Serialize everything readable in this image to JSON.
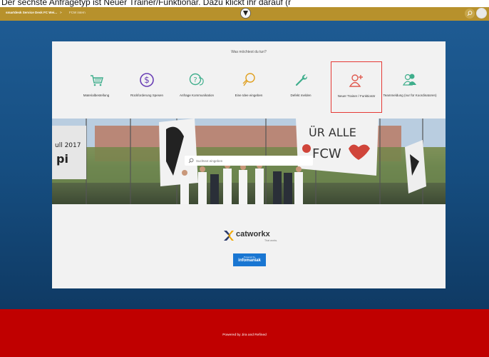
{
  "caption": "Der sechste Anfragetyp ist Neuer Trainer/Funktionär. Dazu klickt ihr darauf (r",
  "topbar": {
    "breadcrumb_portal": "smartdesk Service Desk FC Wei...",
    "breadcrumb_sep": ">",
    "breadcrumb_page": "FCW intern"
  },
  "card": {
    "question": "Was möchtest du tun?",
    "tiles": [
      {
        "label": "Materialbestellung",
        "icon": "cart-icon"
      },
      {
        "label": "Rückforderung Spesen",
        "icon": "dollar-icon"
      },
      {
        "label": "Anfrage Kommunikation",
        "icon": "chat-question-icon"
      },
      {
        "label": "Eine Idee eingeben",
        "icon": "lightbulb-icon"
      },
      {
        "label": "Defekt melden",
        "icon": "wrench-icon"
      },
      {
        "label": "Neuer Trainer / Funktionär",
        "icon": "add-person-icon"
      },
      {
        "label": "Teammeldung (nur für Koordinatoren)",
        "icon": "team-icon"
      }
    ],
    "search_placeholder": "Suchtext eingeben",
    "banner_texts": {
      "year": "ull 2017",
      "fragment": "pi",
      "flag1": "ÜR ALLE",
      "flag2": "FCW"
    }
  },
  "brand": {
    "name": "catworkx",
    "tagline": "That works.",
    "powered_small": "Powered by",
    "powered_name": "infomaniak"
  },
  "footer": {
    "text": "Powered by Jira and Refined"
  },
  "colors": {
    "topbar": "#b7912c",
    "accent": "#3fae8c",
    "highlight": "#e53935",
    "footer": "#c00000"
  }
}
